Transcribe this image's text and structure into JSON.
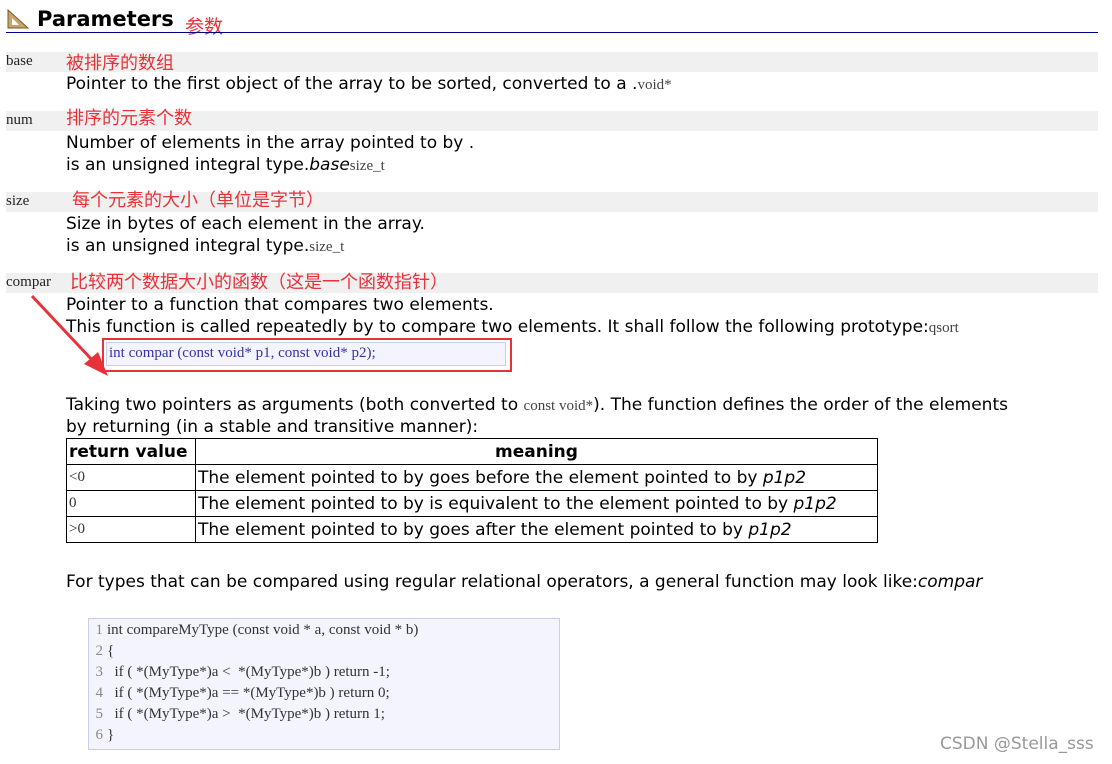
{
  "header": {
    "title": "Parameters",
    "annotation": "参数"
  },
  "params": [
    {
      "name": "base",
      "note": "被排序的数组",
      "desc1": "Pointer to the first object of the array to be sorted, converted to a .",
      "desc1_code": "void*"
    },
    {
      "name": "num",
      "note": "排序的元素个数",
      "desc1": "Number of elements in the array pointed to by .",
      "desc2": "is an unsigned integral type.",
      "desc2_it": "base",
      "desc2_code": "size_t"
    },
    {
      "name": "size",
      "note": "每个元素的大小（单位是字节）",
      "desc1": "Size in bytes of each element in the array.",
      "desc2": "is an unsigned integral type.",
      "desc2_code": "size_t"
    },
    {
      "name": "compar",
      "note": "比较两个数据大小的函数（这是一个函数指针）",
      "desc1": "Pointer to a function that compares two elements.",
      "desc2": "This function is called repeatedly by to compare two elements. It shall follow the following prototype:",
      "desc2_code": "qsort"
    }
  ],
  "prototype": "int compar (const void* p1, const void* p2);",
  "taking": {
    "pre": "Taking two pointers as arguments (both converted to ",
    "code": "const void*",
    "post": "). The function defines the order of the elements",
    "line2": "by returning (in a stable and transitive manner):"
  },
  "table": {
    "headers": [
      "return value",
      "meaning"
    ],
    "rows": [
      {
        "val": "<0",
        "meaning": "The element pointed to by goes before the element pointed to by ",
        "it": "p1p2"
      },
      {
        "val": "0",
        "meaning": "The element pointed to by is equivalent to the element pointed to by ",
        "it": "p1p2"
      },
      {
        "val": ">0",
        "meaning": "The element pointed to by goes after the element pointed to by ",
        "it": "p1p2"
      }
    ]
  },
  "general": {
    "text": "For types that can be compared using regular relational operators, a general function may look like:",
    "it": "compar"
  },
  "code_lines": [
    {
      "n": "1",
      "t": "int compareMyType (const void * a, const void * b)"
    },
    {
      "n": "2",
      "t": "{"
    },
    {
      "n": "3",
      "t": "  if ( *(MyType*)a <  *(MyType*)b ) return -1;"
    },
    {
      "n": "4",
      "t": "  if ( *(MyType*)a == *(MyType*)b ) return 0;"
    },
    {
      "n": "5",
      "t": "  if ( *(MyType*)a >  *(MyType*)b ) return 1;"
    },
    {
      "n": "6",
      "t": "}"
    }
  ],
  "watermark": "CSDN @Stella_sss",
  "colors": {
    "annotation": "#e8323a",
    "rule": "#000080",
    "code_bg": "#f4f4ff"
  }
}
